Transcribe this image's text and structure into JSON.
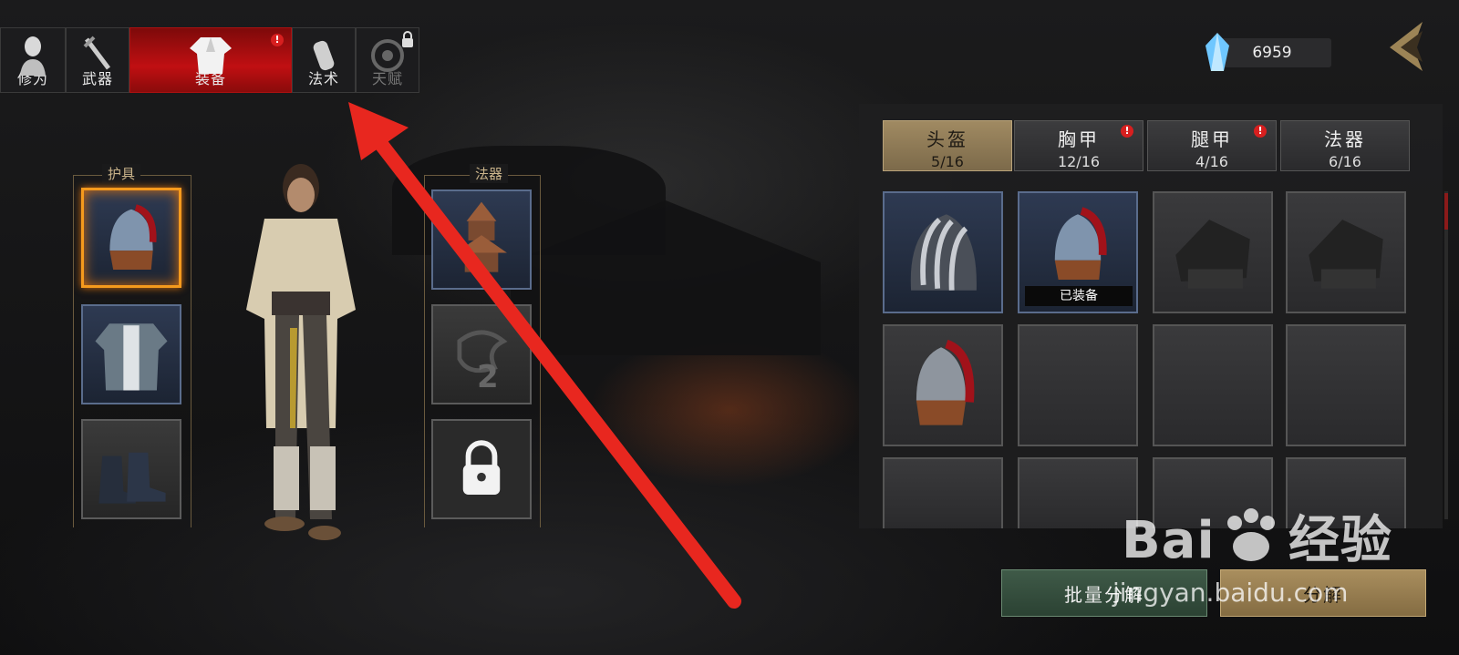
{
  "tabs": [
    {
      "label": "修为",
      "icon": "cultivation-figure-icon",
      "active": false
    },
    {
      "label": "武器",
      "icon": "sword-icon",
      "active": false
    },
    {
      "label": "装备",
      "icon": "robe-icon",
      "active": true,
      "badge": "!"
    },
    {
      "label": "法术",
      "icon": "gourd-bottle-icon",
      "active": false
    },
    {
      "label": "天赋",
      "icon": "yin-yang-icon",
      "active": false,
      "locked": true
    }
  ],
  "currency": {
    "icon": "crystal-gem-icon",
    "value": "6959"
  },
  "back": {
    "icon": "back-arrow-icon"
  },
  "left_column": {
    "title": "护具",
    "slots": [
      "helmet-item-icon",
      "chest-armor-item-icon",
      "boots-item-icon"
    ]
  },
  "right_column": {
    "title": "法器",
    "slots": [
      "pagoda-artifact-icon",
      "empty-artifact-slot-icon",
      "lock-icon"
    ],
    "slot2_number": "2"
  },
  "categories": [
    {
      "name": "头盔",
      "count": "5/16",
      "active": true
    },
    {
      "name": "胸甲",
      "count": "12/16",
      "badge": "!"
    },
    {
      "name": "腿甲",
      "count": "4/16",
      "badge": "!"
    },
    {
      "name": "法器",
      "count": "6/16"
    }
  ],
  "inventory": {
    "equipped_label": "已装备",
    "items": [
      "ribbed-helmet-icon",
      "plumed-helmet-icon",
      "cloth-hat-icon",
      "cloth-hat-icon",
      "plumed-helmet-icon",
      "",
      "",
      "",
      "",
      "",
      "",
      ""
    ]
  },
  "buttons": {
    "batch": "批量分解",
    "decompose": "分解"
  },
  "watermark": {
    "brand": "Bai",
    "suffix": "经验",
    "url": "jingyan.baidu.com"
  },
  "colors": {
    "active_tab": "#c00f12",
    "selected_slot": "#f59a1d",
    "category_active": "#a08a62",
    "arrow": "#e8271f"
  }
}
